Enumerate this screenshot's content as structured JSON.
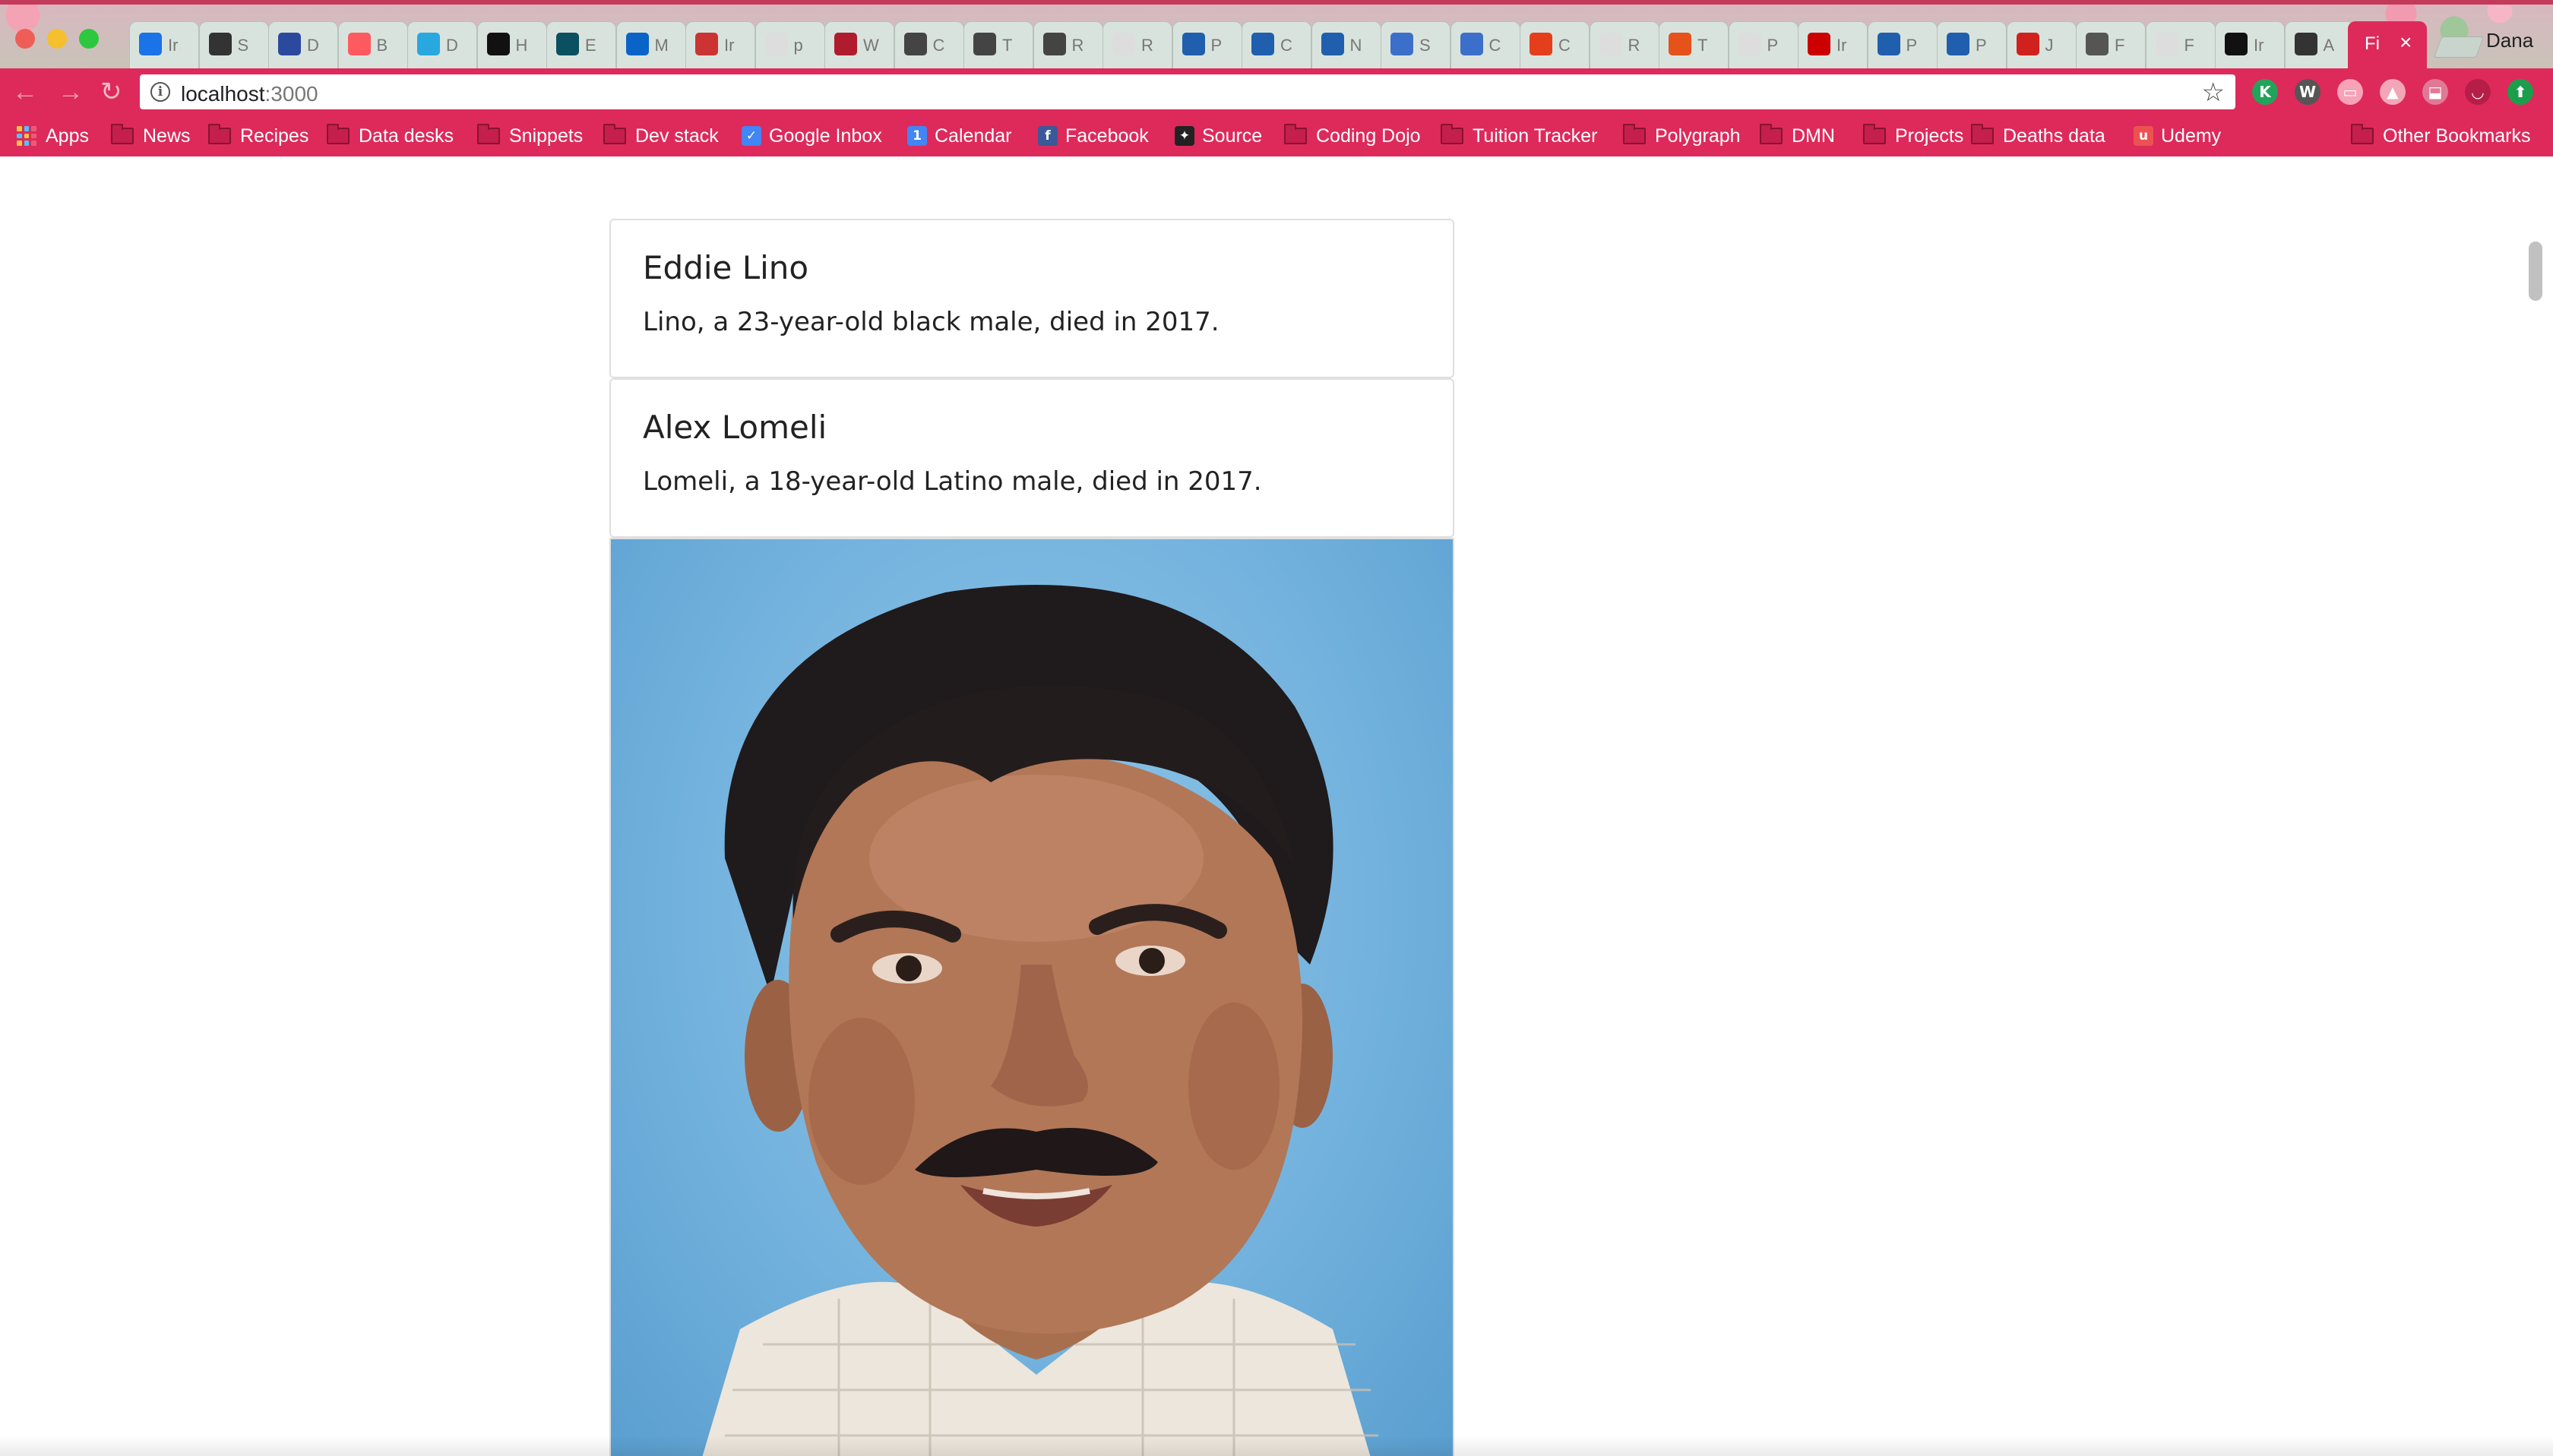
{
  "browser": {
    "active_tab_title": "Fi",
    "tabs": [
      {
        "icon": "inbox-icon",
        "title": "Ir",
        "color": "#1a73e8"
      },
      {
        "icon": "bar-chart-icon",
        "title": "S",
        "color": "#333333"
      },
      {
        "icon": "d-icon",
        "title": "D",
        "color": "#2b4a9e"
      },
      {
        "icon": "airbnb-icon",
        "title": "B",
        "color": "#ff5a5f"
      },
      {
        "icon": "d-icon",
        "title": "D",
        "color": "#29a8e0"
      },
      {
        "icon": "nyt-icon",
        "title": "H",
        "color": "#111111"
      },
      {
        "icon": "cp-icon",
        "title": "E",
        "color": "#0a5060"
      },
      {
        "icon": "outlook-icon",
        "title": "M",
        "color": "#0a64c8"
      },
      {
        "icon": "newspaper-icon",
        "title": "Ir",
        "color": "#cc3333"
      },
      {
        "icon": "page-icon",
        "title": "p",
        "color": "#dddddd"
      },
      {
        "icon": "n-icon",
        "title": "W",
        "color": "#b01b2e"
      },
      {
        "icon": "s-icon",
        "title": "C",
        "color": "#444444"
      },
      {
        "icon": "s-icon",
        "title": "T",
        "color": "#444444"
      },
      {
        "icon": "s-icon",
        "title": "R",
        "color": "#444444"
      },
      {
        "icon": "page-icon",
        "title": "R",
        "color": "#dddddd"
      },
      {
        "icon": "cdc-icon",
        "title": "P",
        "color": "#1f5fae"
      },
      {
        "icon": "cdc-icon",
        "title": "C",
        "color": "#1f5fae"
      },
      {
        "icon": "cdc-icon",
        "title": "N",
        "color": "#1f5fae"
      },
      {
        "icon": "grid-icon",
        "title": "S",
        "color": "#3b6fc9"
      },
      {
        "icon": "grid-icon",
        "title": "C",
        "color": "#3b6fc9"
      },
      {
        "icon": "t-icon",
        "title": "C",
        "color": "#e53e1a"
      },
      {
        "icon": "page-icon",
        "title": "R",
        "color": "#dddddd"
      },
      {
        "icon": "bt-icon",
        "title": "T",
        "color": "#e5521a"
      },
      {
        "icon": "page-icon",
        "title": "P",
        "color": "#dddddd"
      },
      {
        "icon": "cnn-icon",
        "title": "Ir",
        "color": "#cc0000"
      },
      {
        "icon": "cdc-icon",
        "title": "P",
        "color": "#1f5fae"
      },
      {
        "icon": "cdc-icon",
        "title": "P",
        "color": "#1f5fae"
      },
      {
        "icon": "di-icon",
        "title": "J",
        "color": "#d0211c"
      },
      {
        "icon": "book-icon",
        "title": "F",
        "color": "#555555"
      },
      {
        "icon": "page-icon",
        "title": "F",
        "color": "#dddddd"
      },
      {
        "icon": "github-icon",
        "title": "Ir",
        "color": "#111111"
      },
      {
        "icon": "bar-chart-icon",
        "title": "A",
        "color": "#333333"
      }
    ],
    "profile_name": "Dana",
    "url_host": "localhost",
    "url_port": ":3000",
    "bookmarks": [
      {
        "label": "Apps",
        "icon": "apps-icon"
      },
      {
        "label": "News",
        "icon": "folder-icon"
      },
      {
        "label": "Recipes",
        "icon": "folder-icon"
      },
      {
        "label": "Data desks",
        "icon": "folder-icon"
      },
      {
        "label": "Snippets",
        "icon": "folder-icon"
      },
      {
        "label": "Dev stack",
        "icon": "folder-icon"
      },
      {
        "label": "Google Inbox",
        "icon": "inbox-icon"
      },
      {
        "label": "Calendar",
        "icon": "calendar-icon"
      },
      {
        "label": "Facebook",
        "icon": "facebook-icon"
      },
      {
        "label": "Source",
        "icon": "source-icon"
      },
      {
        "label": "Coding Dojo",
        "icon": "folder-icon"
      },
      {
        "label": "Tuition Tracker",
        "icon": "folder-icon"
      },
      {
        "label": "Polygraph",
        "icon": "folder-icon"
      },
      {
        "label": "DMN",
        "icon": "folder-icon"
      },
      {
        "label": "Projects",
        "icon": "folder-icon"
      },
      {
        "label": "Deaths data",
        "icon": "folder-icon"
      },
      {
        "label": "Udemy",
        "icon": "udemy-icon"
      }
    ],
    "other_bookmarks": "Other Bookmarks",
    "extensions": [
      "k-extension-icon",
      "w-extension-icon",
      "cast-icon",
      "drive-icon",
      "inbox-tray-icon",
      "pocket-icon",
      "upload-icon"
    ]
  },
  "records": [
    {
      "name": "Eddie Lino",
      "summary": "Lino, a 23-year-old black male, died in 2017."
    },
    {
      "name": "Alex Lomeli",
      "summary": "Lomeli, a 18-year-old Latino male, died in 2017."
    }
  ],
  "photo": {
    "subject": "portrait-photo",
    "background": "#7ab8e0"
  },
  "colors": {
    "brand": "#dd2a5b",
    "card_border": "#dfdfdf",
    "text": "#222222"
  }
}
